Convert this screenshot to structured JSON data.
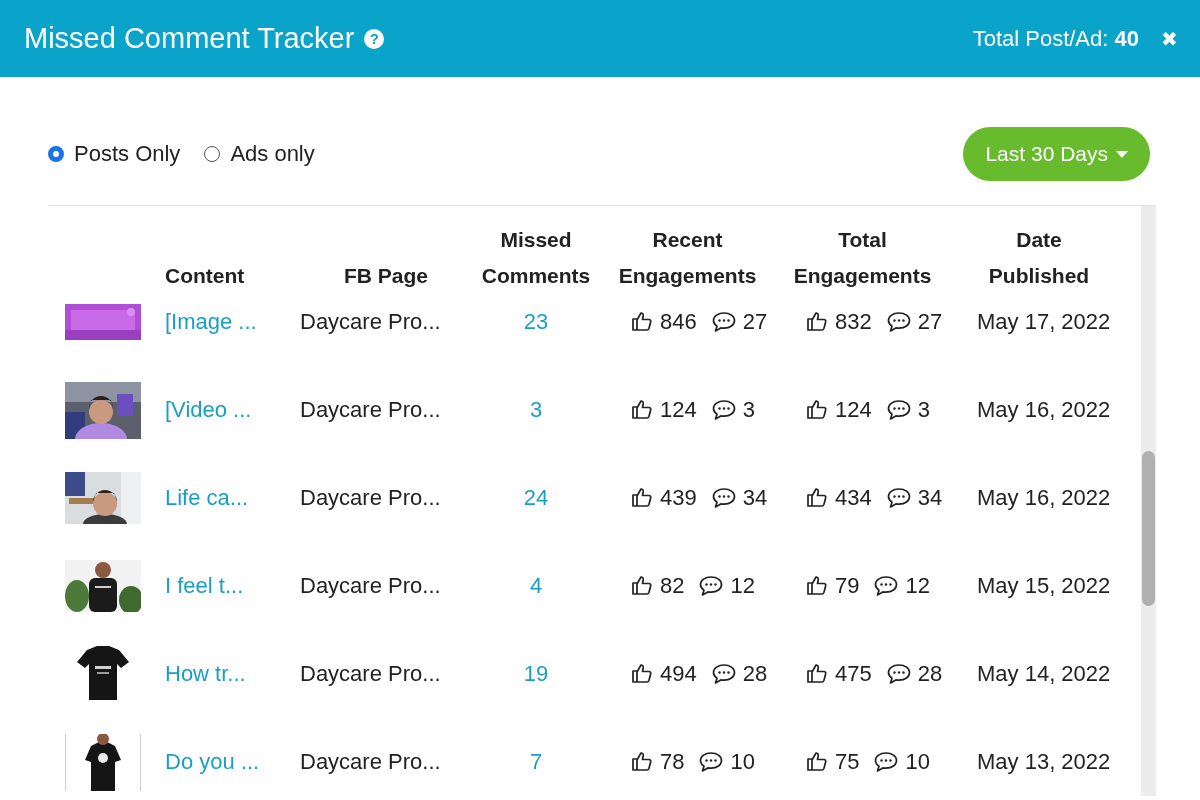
{
  "header": {
    "title": "Missed Comment Tracker",
    "help_icon": "?",
    "total_label": "Total Post/Ad:",
    "total_value": "40",
    "close_icon": "✖"
  },
  "filters": [
    {
      "label": "Posts Only",
      "selected": true
    },
    {
      "label": "Ads only",
      "selected": false
    }
  ],
  "date_range": "Last 30 Days",
  "table": {
    "columns": [
      "Content",
      "FB Page",
      "Missed Comments",
      "Recent Engagements",
      "Total Engagements",
      "Date Published"
    ],
    "rows": [
      {
        "content": "[Image ...",
        "fb_page": "Daycare Pro...",
        "missed_comments": "23",
        "recent_likes": "846",
        "recent_comments": "27",
        "total_likes": "832",
        "total_comments": "27",
        "date": "May 17, 2022"
      },
      {
        "content": "[Video ...",
        "fb_page": "Daycare Pro...",
        "missed_comments": "3",
        "recent_likes": "124",
        "recent_comments": "3",
        "total_likes": "124",
        "total_comments": "3",
        "date": "May 16, 2022"
      },
      {
        "content": "Life ca...",
        "fb_page": "Daycare Pro...",
        "missed_comments": "24",
        "recent_likes": "439",
        "recent_comments": "34",
        "total_likes": "434",
        "total_comments": "34",
        "date": "May 16, 2022"
      },
      {
        "content": "I feel t...",
        "fb_page": "Daycare Pro...",
        "missed_comments": "4",
        "recent_likes": "82",
        "recent_comments": "12",
        "total_likes": "79",
        "total_comments": "12",
        "date": "May 15, 2022"
      },
      {
        "content": "How tr...",
        "fb_page": "Daycare Pro...",
        "missed_comments": "19",
        "recent_likes": "494",
        "recent_comments": "28",
        "total_likes": "475",
        "total_comments": "28",
        "date": "May 14, 2022"
      },
      {
        "content": "Do you ...",
        "fb_page": "Daycare Pro...",
        "missed_comments": "7",
        "recent_likes": "78",
        "recent_comments": "10",
        "total_likes": "75",
        "total_comments": "10",
        "date": "May 13, 2022"
      }
    ]
  }
}
